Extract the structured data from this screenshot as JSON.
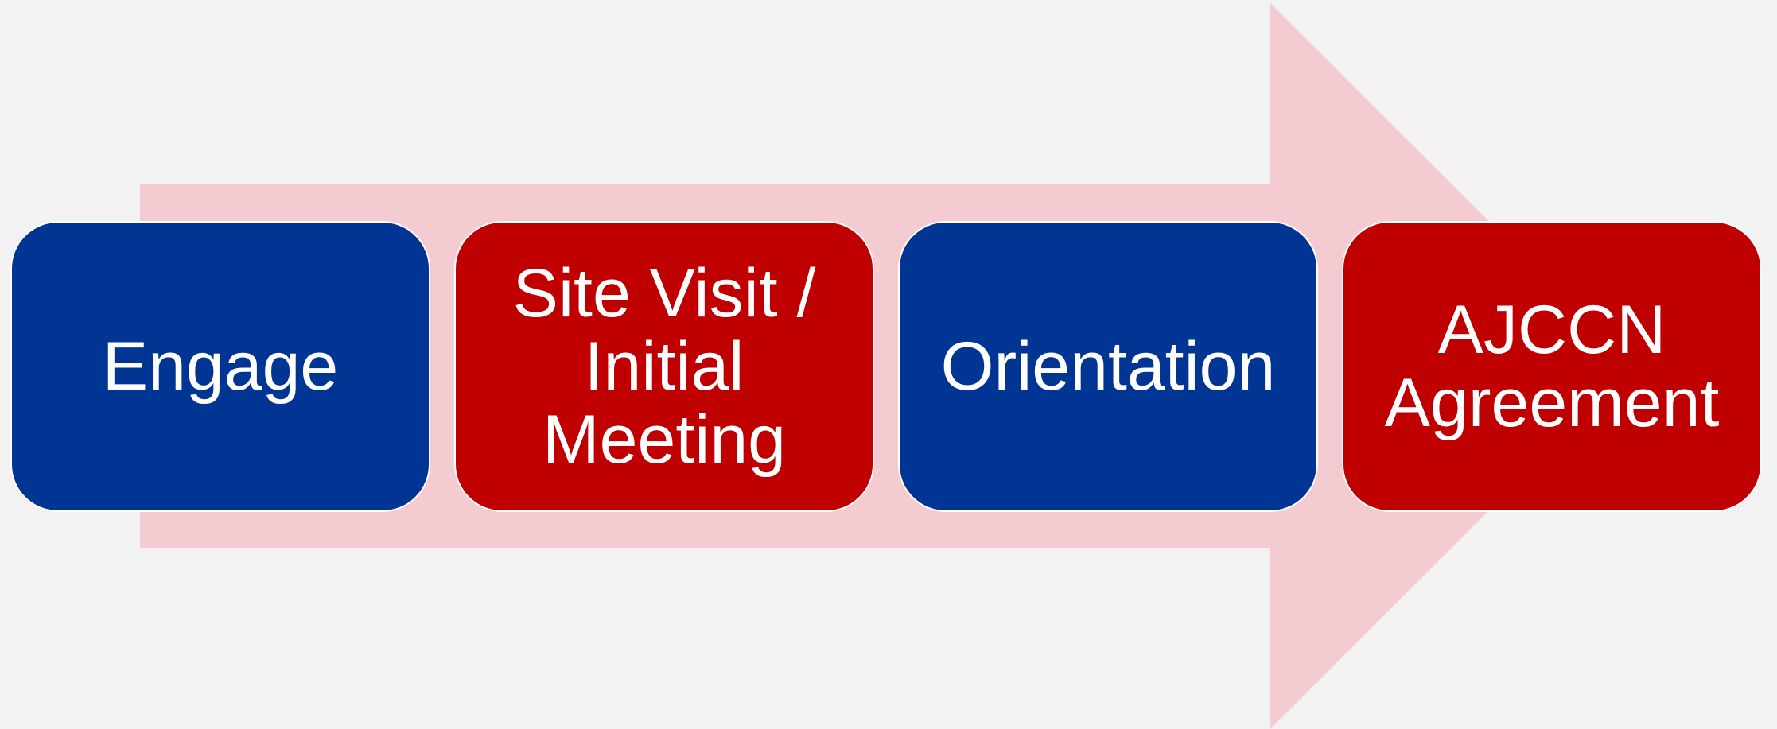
{
  "diagram": {
    "background_color": "#f2f2f2",
    "arrow_color": "#f4cbd0",
    "steps": [
      {
        "label": "Engage",
        "color": "#003594"
      },
      {
        "label": "Site Visit / Initial Meeting",
        "color": "#c00000"
      },
      {
        "label": "Orientation",
        "color": "#003594"
      },
      {
        "label": "AJCCN Agreement",
        "color": "#c00000"
      }
    ]
  }
}
